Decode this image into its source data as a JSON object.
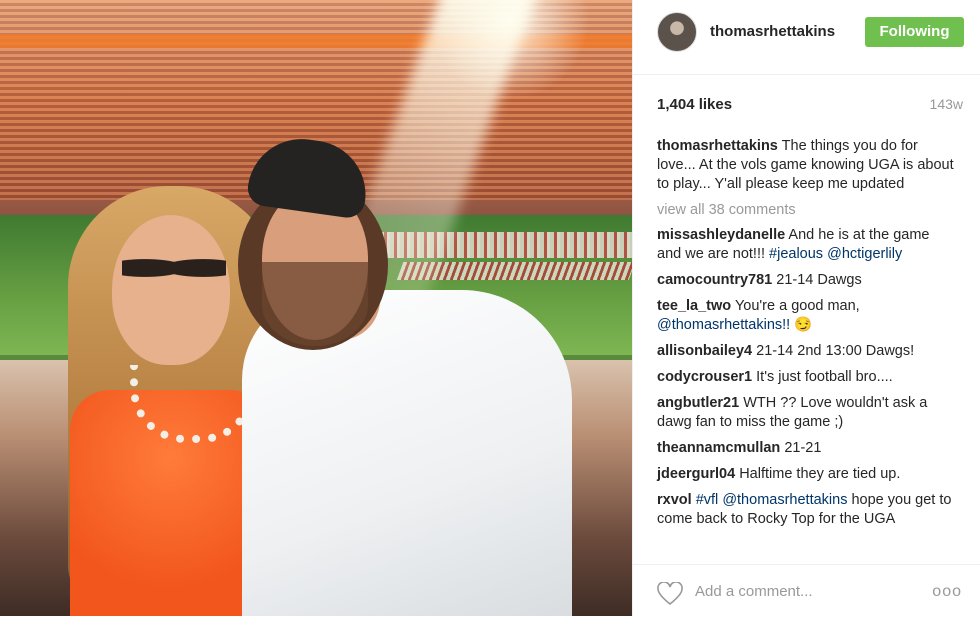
{
  "post": {
    "image_alt": "photo",
    "username": "thomasrhettakins",
    "follow_label": "Following",
    "likes": "1,404 likes",
    "age": "143w",
    "caption_user": "thomasrhettakins",
    "caption_text": "The things you do for love... At the vols game knowing UGA is about to play... Y'all please keep me updated",
    "view_all": "view all 38 comments",
    "add_comment_placeholder": "Add a comment...",
    "more_label": "ooo"
  },
  "comments": [
    {
      "user": "missashleydanelle",
      "text": "And he is at the game and we are not!!!",
      "tags": [
        "#jealous",
        "@hctigerlily"
      ]
    },
    {
      "user": "camocountry781",
      "text": "21-14 Dawgs"
    },
    {
      "user": "tee_la_two",
      "text": "You're a good man,",
      "tags": [
        "@thomasrhettakins!!"
      ],
      "suffix": " 😏"
    },
    {
      "user": "allisonbailey4",
      "text": "21-14 2nd 13:00 Dawgs!"
    },
    {
      "user": "codycrouser1",
      "text": "It's just football bro...."
    },
    {
      "user": "angbutler21",
      "text": "WTH ?? Love wouldn't ask a dawg fan to miss the game ;)"
    },
    {
      "user": "theannamcmullan",
      "text": "21-21"
    },
    {
      "user": "jdeergurl04",
      "text": "Halftime they are tied up."
    },
    {
      "user": "rxvol",
      "text": "",
      "tags": [
        "#vfl",
        "@thomasrhettakins"
      ],
      "suffix": " hope you get to come back to Rocky Top for the UGA"
    }
  ],
  "colors": {
    "follow_button": "#70c050",
    "hashtag": "#003569",
    "muted": "#999999"
  },
  "icons": {
    "heart": "heart-outline-icon",
    "more": "more-options-icon"
  }
}
